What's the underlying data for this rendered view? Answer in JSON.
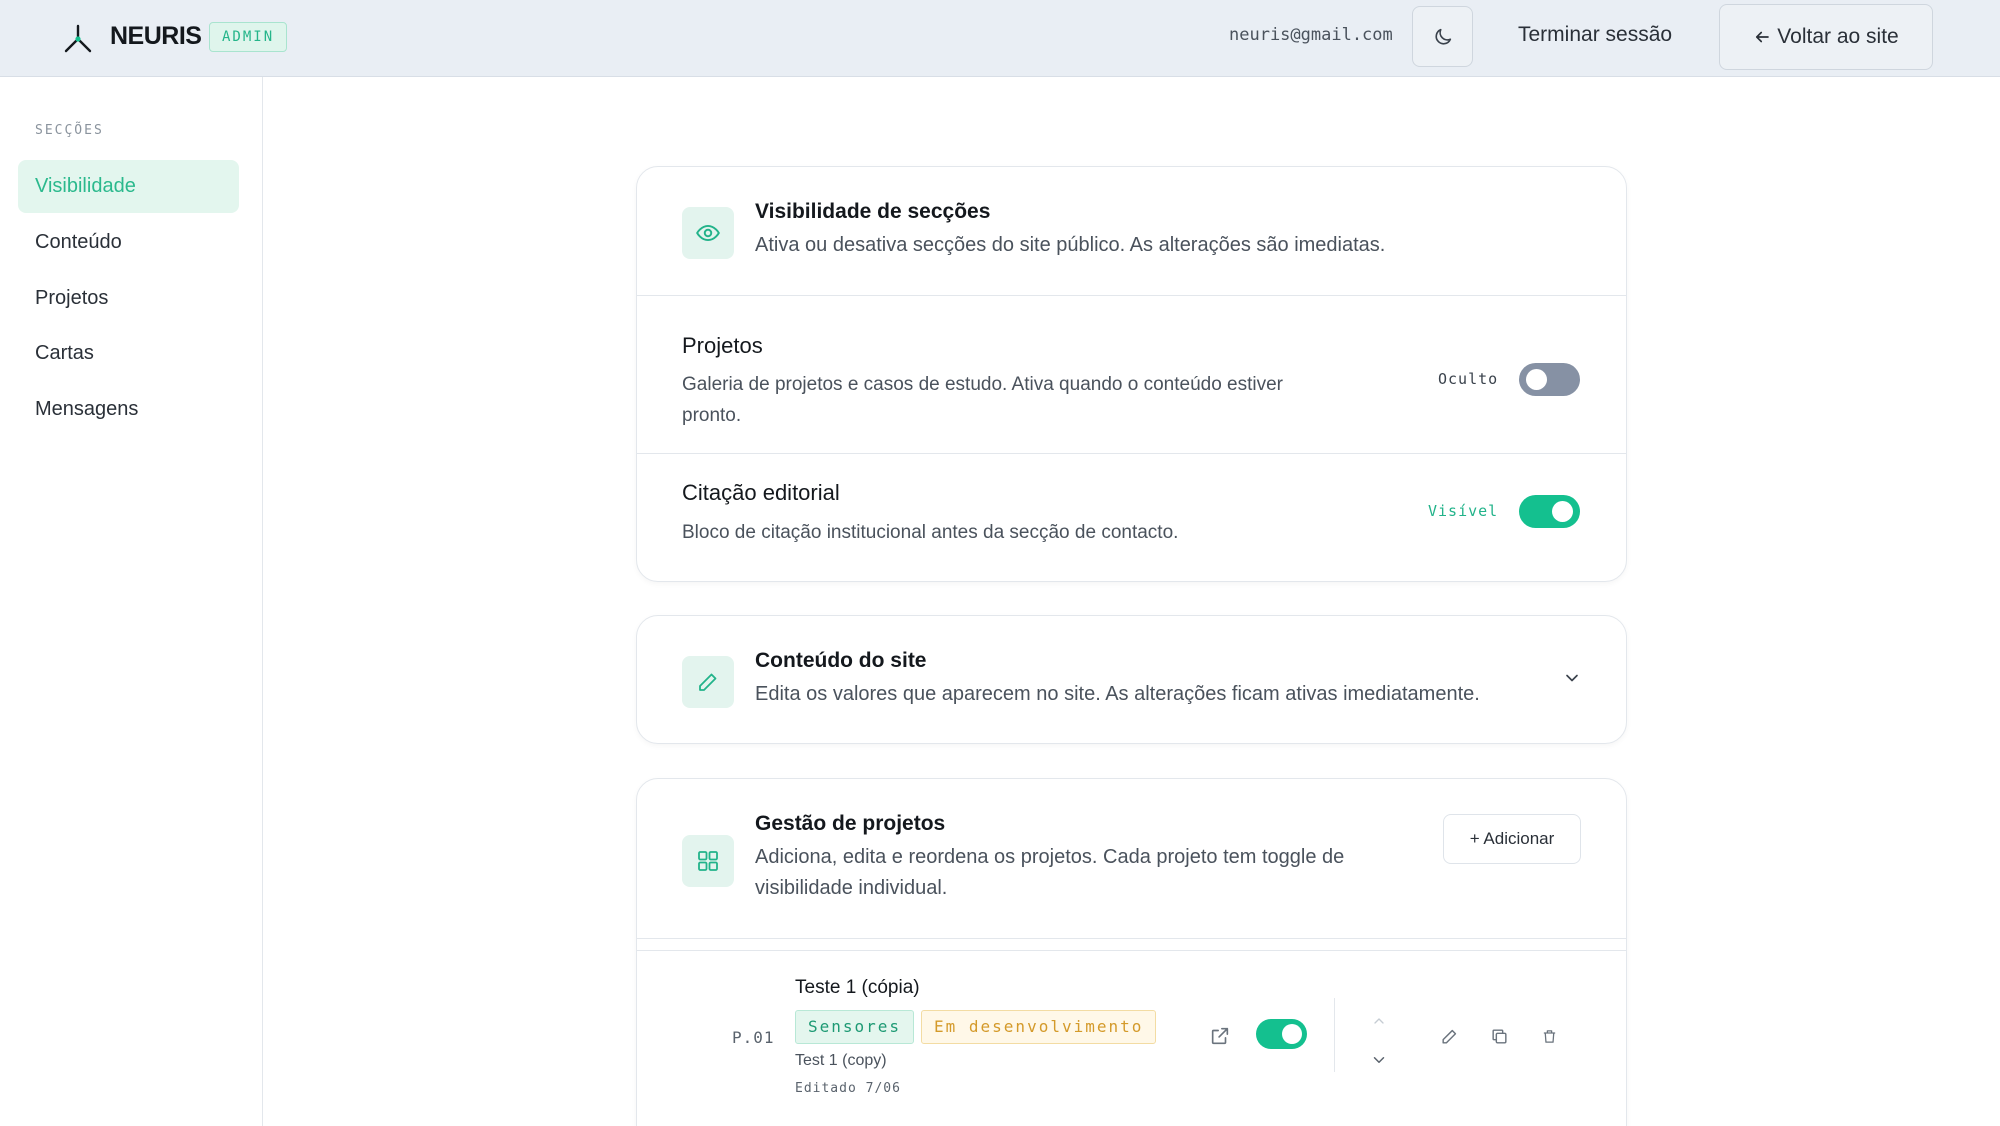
{
  "header": {
    "brand": "NEURIS",
    "badge": "ADMIN",
    "email": "neuris@gmail.com",
    "theme_icon": "moon-icon",
    "logout_label": "Terminar sessão",
    "back_label": "Voltar ao site",
    "back_icon": "arrow-left-icon"
  },
  "sidebar": {
    "heading": "SECÇÕES",
    "items": [
      {
        "label": "Visibilidade",
        "active": true
      },
      {
        "label": "Conteúdo",
        "active": false
      },
      {
        "label": "Projetos",
        "active": false
      },
      {
        "label": "Cartas",
        "active": false
      },
      {
        "label": "Mensagens",
        "active": false
      }
    ]
  },
  "visibility": {
    "title": "Visibilidade de secções",
    "description": "Ativa ou desativa secções do site público. As alterações são imediatas.",
    "icon": "eye-icon",
    "rows": [
      {
        "title": "Projetos",
        "description_line1": "Galeria de projetos e casos de estudo. Ativa quando o conteúdo estiver",
        "description_line2": "pronto.",
        "state_label": "Oculto",
        "enabled": false
      },
      {
        "title": "Citação editorial",
        "description": "Bloco de citação institucional antes da secção de contacto.",
        "state_label": "Visível",
        "enabled": true
      }
    ]
  },
  "content": {
    "title": "Conteúdo do site",
    "description": "Edita os valores que aparecem no site. As alterações ficam ativas imediatamente.",
    "icon": "pencil-icon",
    "expand_icon": "chevron-down-icon"
  },
  "projects": {
    "title": "Gestão de projetos",
    "description_line1": "Adiciona, edita e reordena os projetos. Cada projeto tem toggle de",
    "description_line2": "visibilidade individual.",
    "icon": "grid-icon",
    "add_label": "+ Adicionar",
    "items": [
      {
        "number": "P.01",
        "title": "Teste 1 (cópia)",
        "category": "Sensores",
        "status": "Em desenvolvimento",
        "subtitle": "Test 1 (copy)",
        "edited": "Editado 7/06",
        "visible": true
      }
    ]
  },
  "colors": {
    "accent": "#14c08f",
    "accent_soft": "#e3f6ee",
    "toggle_off": "#8691a4",
    "status_warn": "#d49a2a"
  }
}
